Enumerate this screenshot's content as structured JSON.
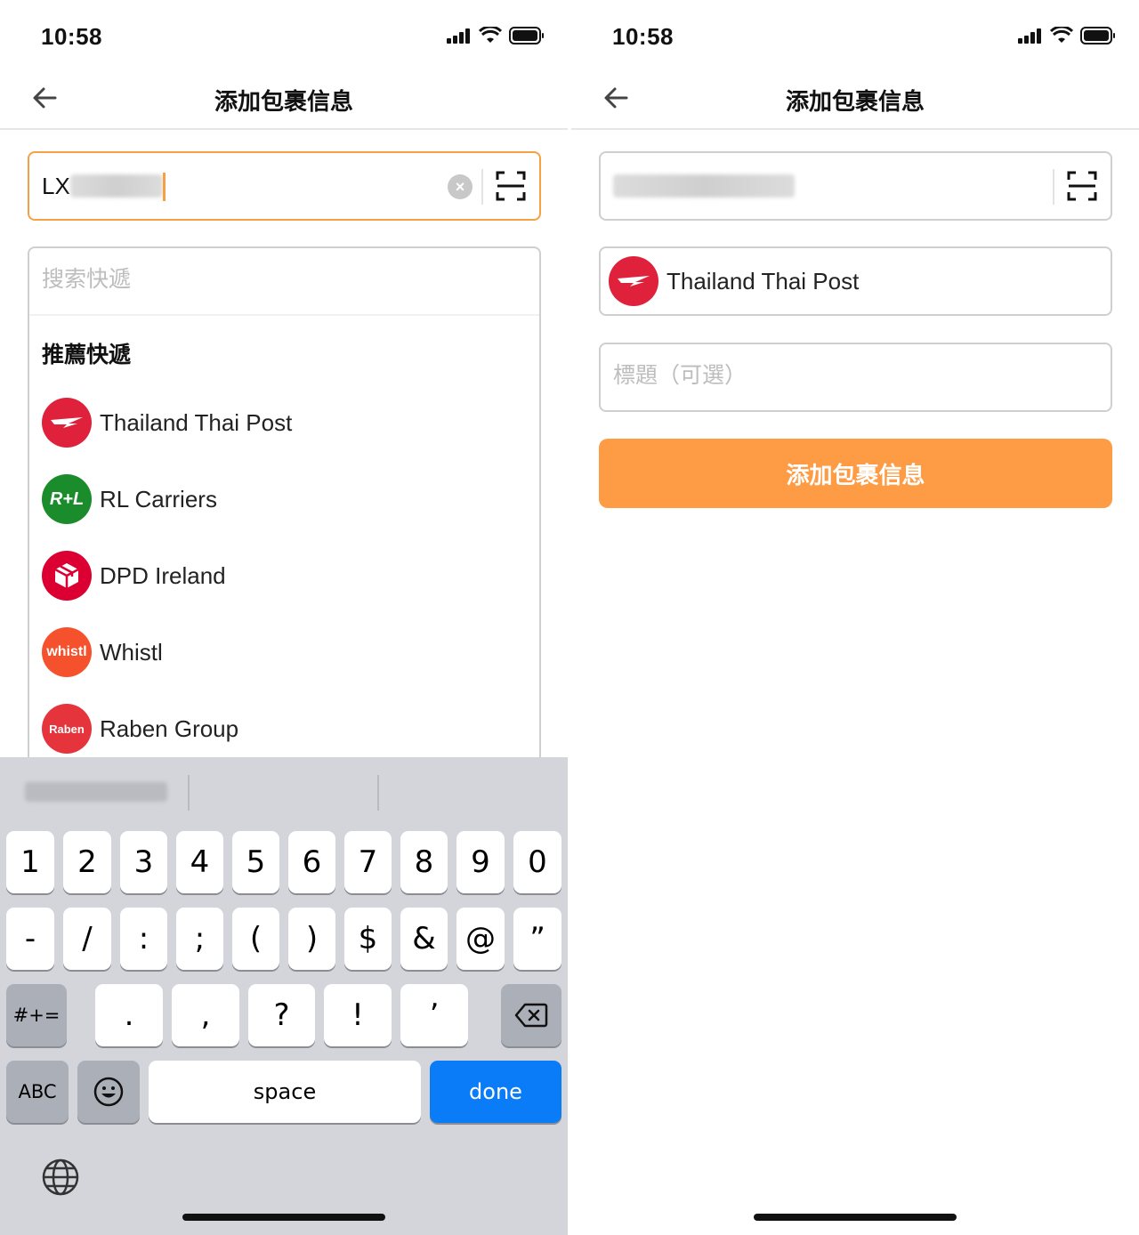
{
  "status": {
    "time": "10:58"
  },
  "left": {
    "nav": {
      "title": "添加包裹信息"
    },
    "tracking": {
      "value_prefix": "LX"
    },
    "dropdown": {
      "search_placeholder": "搜索快遞",
      "section_title": "推薦快遞",
      "carriers": [
        {
          "name": "Thailand Thai Post",
          "logo_text": "",
          "logo_color": "#e0213b"
        },
        {
          "name": "RL Carriers",
          "logo_text": "R+L",
          "logo_color": "#1a8c2b"
        },
        {
          "name": "DPD Ireland",
          "logo_text": "",
          "logo_color": "#dc0032"
        },
        {
          "name": "Whistl",
          "logo_text": "whistl",
          "logo_color": "#f4512c"
        },
        {
          "name": "Raben Group",
          "logo_text": "Raben",
          "logo_color": "#e5343c"
        }
      ]
    },
    "keyboard": {
      "row1": [
        "1",
        "2",
        "3",
        "4",
        "5",
        "6",
        "7",
        "8",
        "9",
        "0"
      ],
      "row2": [
        "-",
        "/",
        ":",
        ";",
        "(",
        ")",
        "$",
        "&",
        "@",
        "”"
      ],
      "row3_left": "#+=",
      "row3": [
        ".",
        ",",
        "?",
        "!",
        "’"
      ],
      "abc": "ABC",
      "space": "space",
      "done": "done"
    }
  },
  "right": {
    "nav": {
      "title": "添加包裹信息"
    },
    "selected_carrier": {
      "name": "Thailand Thai Post"
    },
    "title_placeholder": "標題（可選）",
    "submit_label": "添加包裹信息"
  },
  "colors": {
    "accent": "#fe9c45",
    "focus_border": "#f7a046",
    "done_key": "#0a7cf7"
  },
  "icons": [
    "back-arrow-icon",
    "scan-icon",
    "clear-icon",
    "signal-icon",
    "wifi-icon",
    "battery-icon",
    "emoji-icon",
    "globe-icon",
    "backspace-icon"
  ]
}
